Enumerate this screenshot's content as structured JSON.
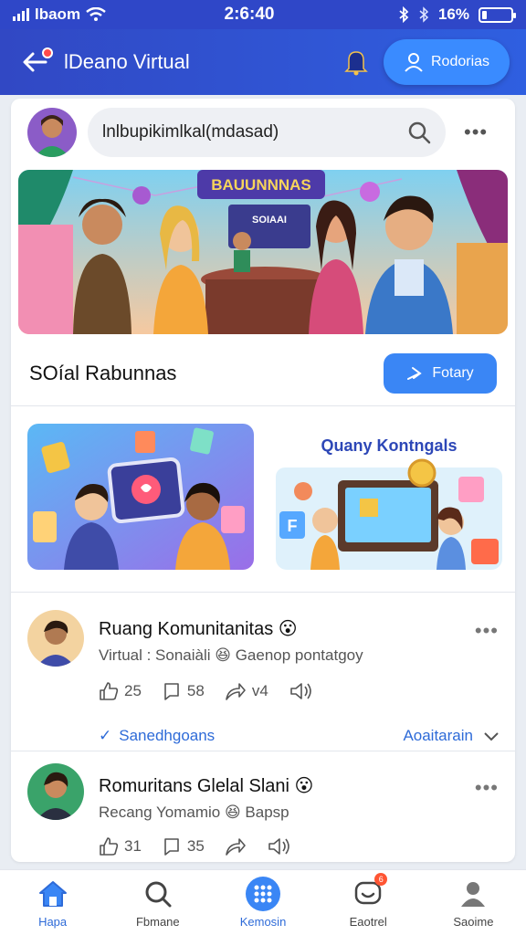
{
  "status_bar": {
    "carrier": "lbaom",
    "time": "2:6:40",
    "battery": "16%",
    "battery_level": 0.16
  },
  "header": {
    "title": "lDeano Virtual",
    "action_label": "Rodorias"
  },
  "search": {
    "value": "lnlbupikimlkal(mdasad)"
  },
  "banner": {
    "sign_text": "BAUUNNNAS",
    "screen_text": "SOIAAI"
  },
  "section": {
    "title": "SOíal Rabunnas",
    "button_label": "Fotary"
  },
  "tile2": {
    "title": "Quany Kontngals"
  },
  "posts": [
    {
      "name": "Ruang Komunitanitas",
      "emoji": "😮",
      "subtitle": "Virtual : Sonaiàli 😆 Gaenop pontatgoy",
      "likes": "25",
      "comments": "58",
      "shares": "v4",
      "link_left": "Sanedhgoans",
      "link_right": "Aoaitarain"
    },
    {
      "name": "Romuritans Glelal Slani",
      "emoji": "😮",
      "subtitle": "Recang Yomamio 😆 Bapsp",
      "likes": "31",
      "comments": "35"
    }
  ],
  "nav": [
    {
      "label": "Hapa",
      "icon": "home-icon"
    },
    {
      "label": "Fbmane",
      "icon": "search-icon"
    },
    {
      "label": "Kemosin",
      "icon": "grid-icon"
    },
    {
      "label": "Eaotrel",
      "icon": "chat-icon",
      "badge": "6"
    },
    {
      "label": "Saoime",
      "icon": "profile-icon"
    }
  ],
  "colors": {
    "primary": "#2f47c8",
    "accent": "#3a86f5",
    "link": "#2e6bd8"
  }
}
